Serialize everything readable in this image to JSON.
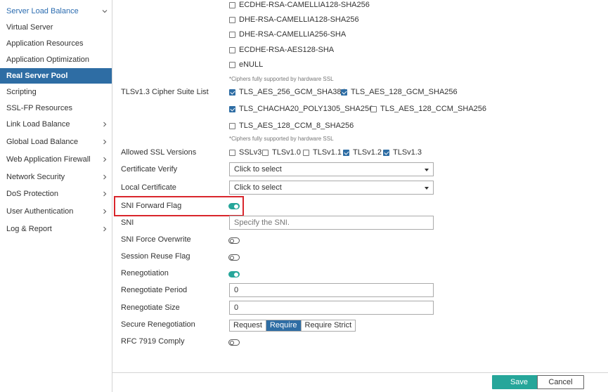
{
  "sidebar": {
    "items": [
      {
        "label": "Server Load Balance",
        "state": "expanded-header"
      },
      {
        "label": "Virtual Server"
      },
      {
        "label": "Application Resources"
      },
      {
        "label": "Application Optimization"
      },
      {
        "label": "Real Server Pool",
        "state": "active"
      },
      {
        "label": "Scripting"
      },
      {
        "label": "SSL-FP Resources"
      },
      {
        "label": "Link Load Balance"
      },
      {
        "label": "Global Load Balance"
      },
      {
        "label": "Web Application Firewall"
      },
      {
        "label": "Network Security"
      },
      {
        "label": "DoS Protection"
      },
      {
        "label": "User Authentication"
      },
      {
        "label": "Log & Report"
      }
    ],
    "active_color": "#2e6da4"
  },
  "ciphers_top": [
    {
      "label": "ECDHE-RSA-CAMELLIA128-SHA256",
      "checked": false
    },
    {
      "label": "DHE-RSA-CAMELLIA128-SHA256",
      "checked": false
    },
    {
      "label": "DHE-RSA-CAMELLIA256-SHA",
      "checked": false
    },
    {
      "label": "ECDHE-RSA-AES128-SHA",
      "checked": false
    },
    {
      "label": "eNULL",
      "checked": false
    }
  ],
  "cipher_note_1": "*Ciphers fully supported by hardware SSL",
  "tls13": {
    "label": "TLSv1.3 Cipher Suite List",
    "options": [
      {
        "label": "TLS_AES_256_GCM_SHA384",
        "checked": true
      },
      {
        "label": "TLS_AES_128_GCM_SHA256",
        "checked": true
      },
      {
        "label": "TLS_CHACHA20_POLY1305_SHA256",
        "checked": true
      },
      {
        "label": "TLS_AES_128_CCM_SHA256",
        "checked": false
      },
      {
        "label": "TLS_AES_128_CCM_8_SHA256",
        "checked": false
      }
    ],
    "note": "*Ciphers fully supported by hardware SSL"
  },
  "ssl_versions": {
    "label": "Allowed SSL Versions",
    "options": [
      {
        "label": "SSLv3",
        "checked": false
      },
      {
        "label": "TLSv1.0",
        "checked": false
      },
      {
        "label": "TLSv1.1",
        "checked": false
      },
      {
        "label": "TLSv1.2",
        "checked": true
      },
      {
        "label": "TLSv1.3",
        "checked": true
      }
    ]
  },
  "certificate_verify": {
    "label": "Certificate Verify",
    "value": "Click to select"
  },
  "local_certificate": {
    "label": "Local Certificate",
    "value": "Click to select"
  },
  "sni_forward_flag": {
    "label": "SNI Forward Flag",
    "on": true
  },
  "sni": {
    "label": "SNI",
    "placeholder": "Specify the SNI."
  },
  "sni_force_overwrite": {
    "label": "SNI Force Overwrite",
    "on": false
  },
  "session_reuse_flag": {
    "label": "Session Reuse Flag",
    "on": false
  },
  "renegotiation": {
    "label": "Renegotiation",
    "on": true
  },
  "renegotiate_period": {
    "label": "Renegotiate Period",
    "value": "0"
  },
  "renegotiate_size": {
    "label": "Renegotiate Size",
    "value": "0"
  },
  "secure_renegotiation": {
    "label": "Secure Renegotiation",
    "options": [
      "Request",
      "Require",
      "Require Strict"
    ],
    "selected": "Require"
  },
  "rfc7919": {
    "label": "RFC 7919 Comply",
    "on": false
  },
  "footer": {
    "save_label": "Save",
    "cancel_label": "Cancel"
  },
  "colors": {
    "accent": "#2e6da4",
    "toggle_on": "#26a69a",
    "highlight": "#d9262c"
  }
}
